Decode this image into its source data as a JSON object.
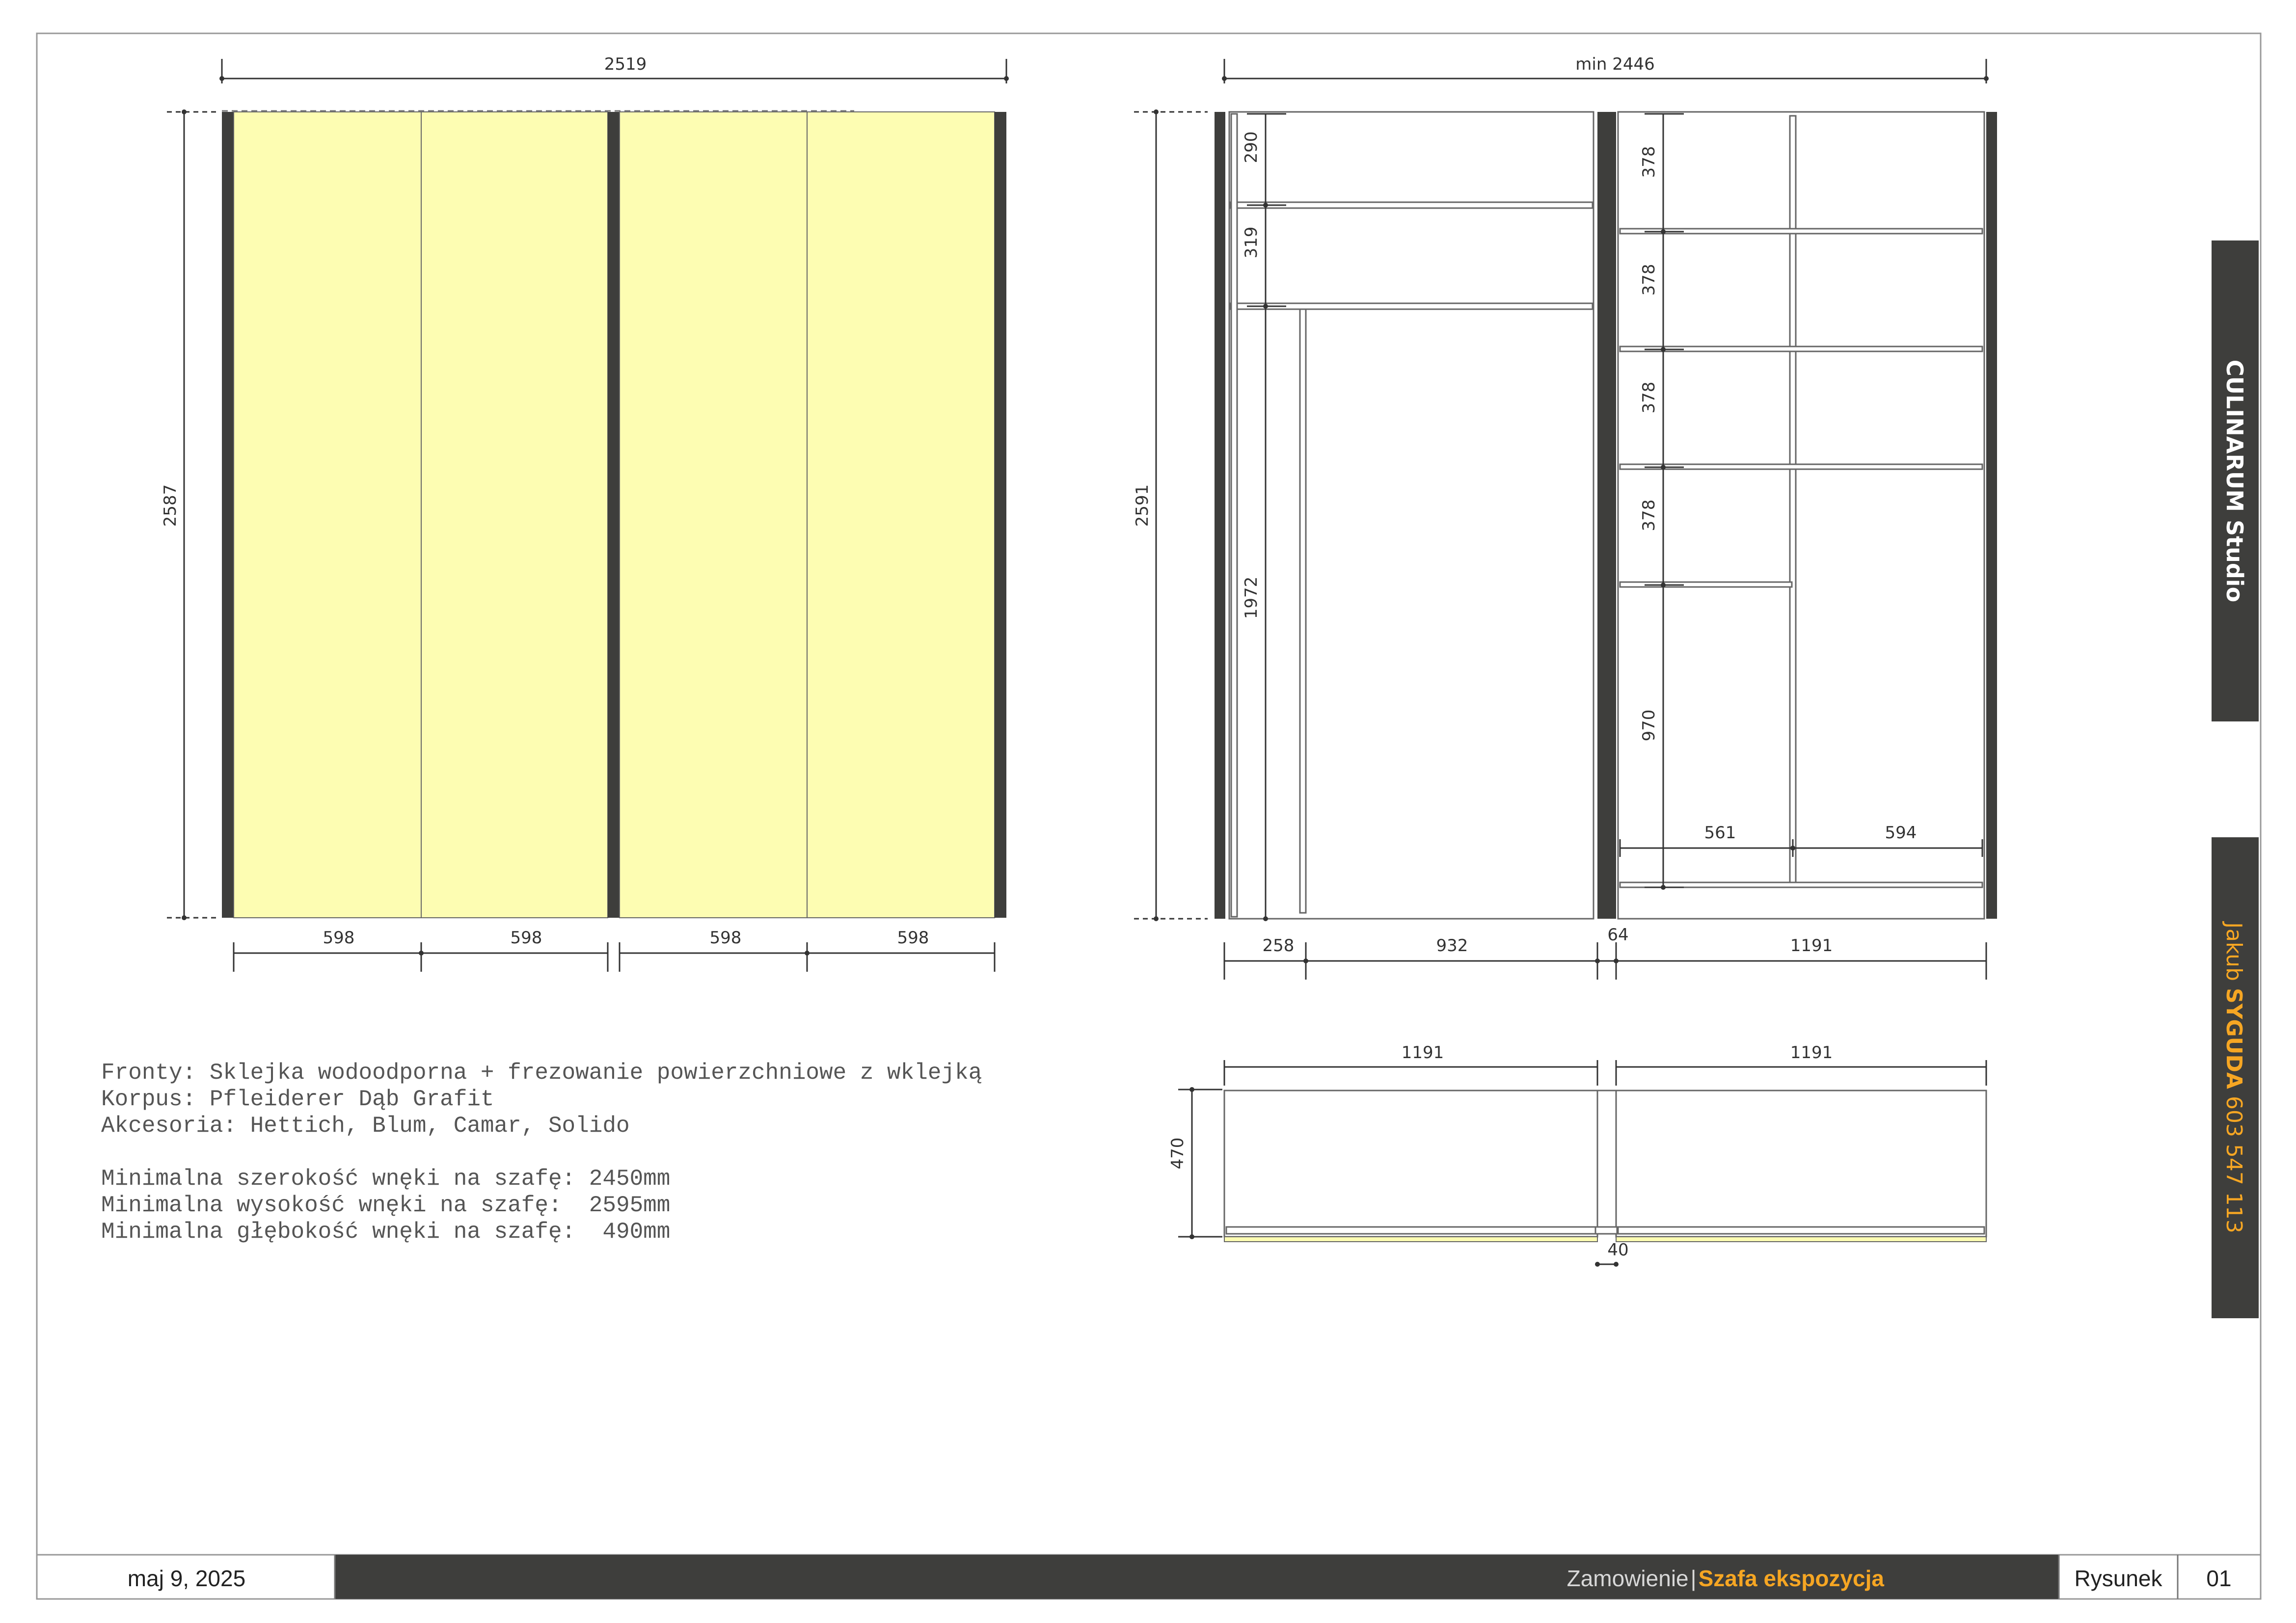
{
  "sidebar": {
    "studio_name": "CULINARUM Studio",
    "designer_first": "Jakub",
    "designer_last": "SYGUDA",
    "phone": "603 547 113"
  },
  "notes": {
    "line1": "Fronty: Sklejka wodoodporna + frezowanie powierzchniowe z wklejką",
    "line2": "Korpus: Pfleiderer Dąb Grafit",
    "line3": "Akcesoria: Hettich, Blum, Camar, Solido",
    "line4": "Minimalna szerokość wnęki na szafę: 2450mm",
    "line5": "Minimalna wysokość wnęki na szafę:  2595mm",
    "line6": "Minimalna głębokość wnęki na szafę:  490mm"
  },
  "front_view": {
    "width_label": "2519",
    "height_label": "2587",
    "door_widths": [
      "598",
      "598",
      "598",
      "598"
    ],
    "front_color": "#fdfdb2"
  },
  "interior_view": {
    "width_label": "min 2446",
    "height_label": "2591",
    "left_section": {
      "heights": [
        "290",
        "319",
        "1972"
      ],
      "widths": [
        "258",
        "932"
      ]
    },
    "gap_label": "64",
    "right_section": {
      "heights": [
        "378",
        "378",
        "378",
        "378",
        "970"
      ],
      "inner_widths": [
        "561",
        "594"
      ],
      "width": "1191"
    }
  },
  "plan_view": {
    "widths": [
      "1191",
      "1191"
    ],
    "depth_label": "470",
    "gap_label": "40"
  },
  "footer": {
    "date": "maj 9, 2025",
    "order_label": "Zamowienie",
    "separator": "|",
    "project_name": "Szafa ekspozycja",
    "drawing_label": "Rysunek",
    "drawing_number": "01"
  },
  "colors": {
    "dark": "#3e3e3c",
    "accent": "#f6a623",
    "front": "#fdfdb2"
  }
}
